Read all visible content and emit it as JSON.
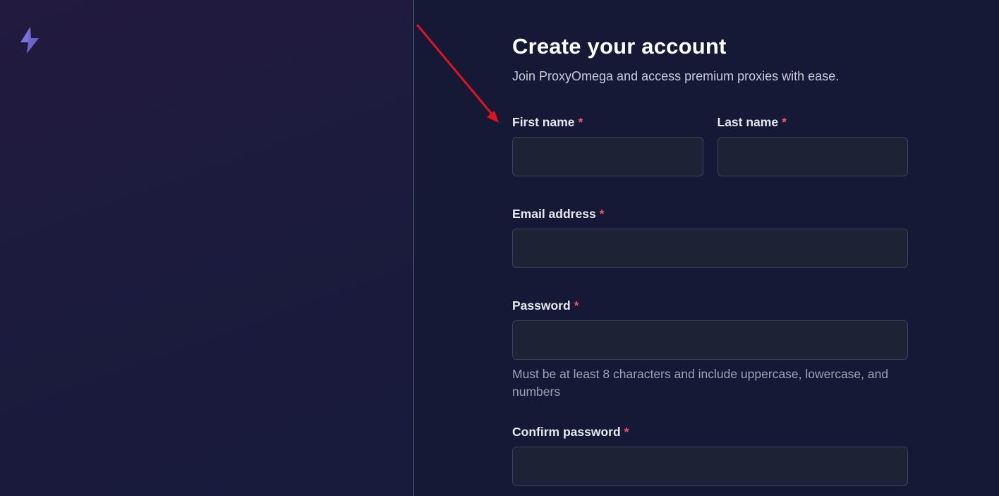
{
  "brand": {
    "logo_icon": "lightning-bolt-icon",
    "logo_color": "#6b63c9"
  },
  "form": {
    "title": "Create your account",
    "subtitle": "Join ProxyOmega and access premium proxies with ease.",
    "required_marker": "*",
    "fields": {
      "first_name": {
        "label": "First name",
        "value": "",
        "placeholder": ""
      },
      "last_name": {
        "label": "Last name",
        "value": "",
        "placeholder": ""
      },
      "email": {
        "label": "Email address",
        "value": "",
        "placeholder": ""
      },
      "password": {
        "label": "Password",
        "value": "",
        "placeholder": "",
        "hint": "Must be at least 8 characters and include uppercase, lowercase, and numbers"
      },
      "confirm_password": {
        "label": "Confirm password",
        "value": "",
        "placeholder": ""
      }
    }
  },
  "annotation": {
    "icon": "red-arrow-icon",
    "color": "#e0141e"
  },
  "colors": {
    "required": "#f0526a",
    "background": "#151936",
    "input_bg": "#1e2235"
  }
}
